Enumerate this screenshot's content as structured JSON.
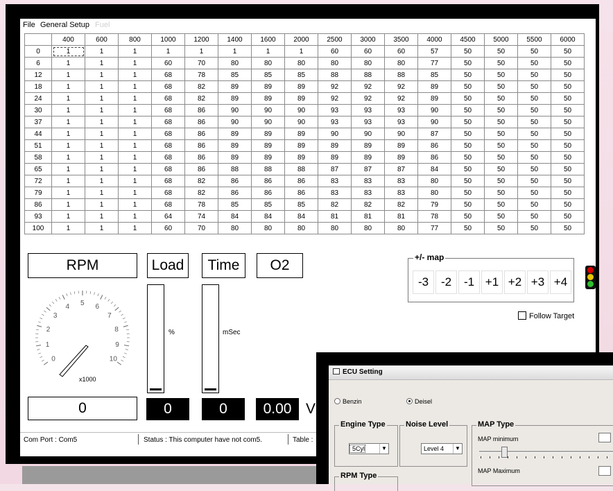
{
  "menu": {
    "file": "File",
    "general_setup": "General Setup",
    "fuel": "Fuel"
  },
  "table": {
    "columns": [
      "400",
      "600",
      "800",
      "1000",
      "1200",
      "1400",
      "1600",
      "2000",
      "2500",
      "3000",
      "3500",
      "4000",
      "4500",
      "5000",
      "5500",
      "6000"
    ],
    "rows": [
      {
        "load": "0",
        "values": [
          "1",
          "1",
          "1",
          "1",
          "1",
          "1",
          "1",
          "1",
          "60",
          "60",
          "60",
          "57",
          "50",
          "50",
          "50",
          "50"
        ]
      },
      {
        "load": "6",
        "values": [
          "1",
          "1",
          "1",
          "60",
          "70",
          "80",
          "80",
          "80",
          "80",
          "80",
          "80",
          "77",
          "50",
          "50",
          "50",
          "50"
        ]
      },
      {
        "load": "12",
        "values": [
          "1",
          "1",
          "1",
          "68",
          "78",
          "85",
          "85",
          "85",
          "88",
          "88",
          "88",
          "85",
          "50",
          "50",
          "50",
          "50"
        ]
      },
      {
        "load": "18",
        "values": [
          "1",
          "1",
          "1",
          "68",
          "82",
          "89",
          "89",
          "89",
          "92",
          "92",
          "92",
          "89",
          "50",
          "50",
          "50",
          "50"
        ]
      },
      {
        "load": "24",
        "values": [
          "1",
          "1",
          "1",
          "68",
          "82",
          "89",
          "89",
          "89",
          "92",
          "92",
          "92",
          "89",
          "50",
          "50",
          "50",
          "50"
        ]
      },
      {
        "load": "30",
        "values": [
          "1",
          "1",
          "1",
          "68",
          "86",
          "90",
          "90",
          "90",
          "93",
          "93",
          "93",
          "90",
          "50",
          "50",
          "50",
          "50"
        ]
      },
      {
        "load": "37",
        "values": [
          "1",
          "1",
          "1",
          "68",
          "86",
          "90",
          "90",
          "90",
          "93",
          "93",
          "93",
          "90",
          "50",
          "50",
          "50",
          "50"
        ]
      },
      {
        "load": "44",
        "values": [
          "1",
          "1",
          "1",
          "68",
          "86",
          "89",
          "89",
          "89",
          "90",
          "90",
          "90",
          "87",
          "50",
          "50",
          "50",
          "50"
        ]
      },
      {
        "load": "51",
        "values": [
          "1",
          "1",
          "1",
          "68",
          "86",
          "89",
          "89",
          "89",
          "89",
          "89",
          "89",
          "86",
          "50",
          "50",
          "50",
          "50"
        ]
      },
      {
        "load": "58",
        "values": [
          "1",
          "1",
          "1",
          "68",
          "86",
          "89",
          "89",
          "89",
          "89",
          "89",
          "89",
          "86",
          "50",
          "50",
          "50",
          "50"
        ]
      },
      {
        "load": "65",
        "values": [
          "1",
          "1",
          "1",
          "68",
          "86",
          "88",
          "88",
          "88",
          "87",
          "87",
          "87",
          "84",
          "50",
          "50",
          "50",
          "50"
        ]
      },
      {
        "load": "72",
        "values": [
          "1",
          "1",
          "1",
          "68",
          "82",
          "86",
          "86",
          "86",
          "83",
          "83",
          "83",
          "80",
          "50",
          "50",
          "50",
          "50"
        ]
      },
      {
        "load": "79",
        "values": [
          "1",
          "1",
          "1",
          "68",
          "82",
          "86",
          "86",
          "86",
          "83",
          "83",
          "83",
          "80",
          "50",
          "50",
          "50",
          "50"
        ]
      },
      {
        "load": "86",
        "values": [
          "1",
          "1",
          "1",
          "68",
          "78",
          "85",
          "85",
          "85",
          "82",
          "82",
          "82",
          "79",
          "50",
          "50",
          "50",
          "50"
        ]
      },
      {
        "load": "93",
        "values": [
          "1",
          "1",
          "1",
          "64",
          "74",
          "84",
          "84",
          "84",
          "81",
          "81",
          "81",
          "78",
          "50",
          "50",
          "50",
          "50"
        ]
      },
      {
        "load": "100",
        "values": [
          "1",
          "1",
          "1",
          "60",
          "70",
          "80",
          "80",
          "80",
          "80",
          "80",
          "80",
          "77",
          "50",
          "50",
          "50",
          "50"
        ]
      }
    ]
  },
  "gauges": {
    "rpm_label": "RPM",
    "load_label": "Load",
    "time_label": "Time",
    "o2_label": "O2",
    "rpm_value": "0",
    "load_value": "0",
    "time_value": "0",
    "o2_value": "0.00",
    "o2_unit": "V",
    "load_unit": "%",
    "time_unit": "mSec",
    "load_level": 0,
    "time_level": 0,
    "tach_scale_label": "x1000",
    "tach_ticks": [
      "0",
      "1",
      "2",
      "3",
      "4",
      "5",
      "6",
      "7",
      "8",
      "9",
      "10"
    ]
  },
  "map_adjust": {
    "title": "+/- map",
    "buttons": [
      "-3",
      "-2",
      "-1",
      "+1",
      "+2",
      "+3",
      "+4"
    ]
  },
  "follow_target": {
    "label": "Follow Target",
    "checked": false
  },
  "status": {
    "com_port": "Com Port : Com5",
    "status_text": "Status : This computer have not com5.",
    "table_text": "Table :"
  },
  "colors": {
    "traffic_red": "#d40000",
    "traffic_yellow": "#e8c600",
    "traffic_green": "#2fbf2f"
  },
  "ecu": {
    "title": "ECU Setting",
    "fuel_benzin": "Benzin",
    "fuel_deisel": "Deisel",
    "selected_fuel": "Deisel",
    "engine_type_title": "Engine Type",
    "engine_type_value": "5Cyl",
    "noise_level_title": "Noise Level",
    "noise_level_value": "Level 4",
    "map_type_title": "MAP Type",
    "map_minimum": "MAP minimum",
    "map_maximum": "MAP Maximum",
    "rpm_type_title": "RPM Type"
  }
}
